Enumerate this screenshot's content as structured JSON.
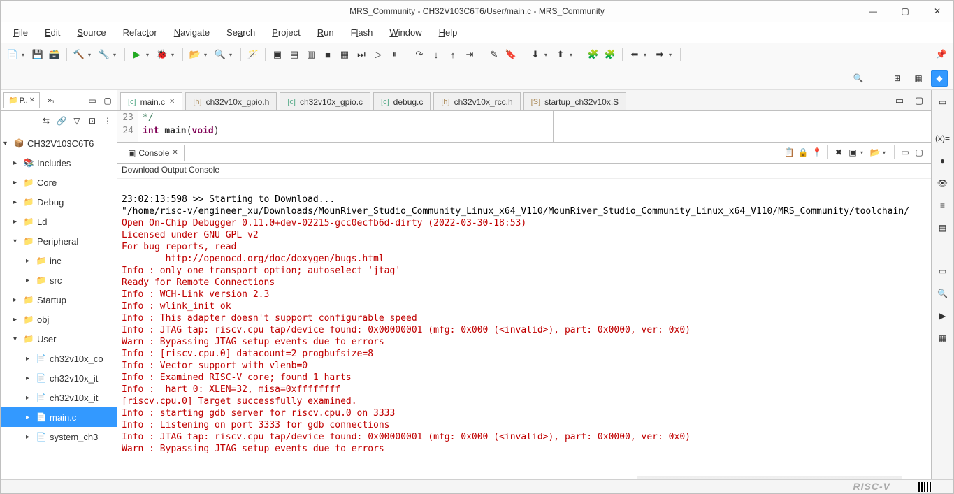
{
  "title": "MRS_Community - CH32V103C6T6/User/main.c - MRS_Community",
  "menus": [
    "File",
    "Edit",
    "Source",
    "Refactor",
    "Navigate",
    "Search",
    "Project",
    "Run",
    "Flash",
    "Window",
    "Help"
  ],
  "project_tree": {
    "root": "CH32V103C6T6",
    "items": [
      {
        "label": "Includes",
        "icon": "📚",
        "depth": 1,
        "arrow": "▸"
      },
      {
        "label": "Core",
        "icon": "📁",
        "depth": 1,
        "arrow": "▸"
      },
      {
        "label": "Debug",
        "icon": "📁",
        "depth": 1,
        "arrow": "▸"
      },
      {
        "label": "Ld",
        "icon": "📁",
        "depth": 1,
        "arrow": "▸"
      },
      {
        "label": "Peripheral",
        "icon": "📁",
        "depth": 1,
        "arrow": "▾"
      },
      {
        "label": "inc",
        "icon": "📁",
        "depth": 2,
        "arrow": "▸"
      },
      {
        "label": "src",
        "icon": "📁",
        "depth": 2,
        "arrow": "▸"
      },
      {
        "label": "Startup",
        "icon": "📁",
        "depth": 1,
        "arrow": "▸"
      },
      {
        "label": "obj",
        "icon": "📁",
        "depth": 1,
        "arrow": "▸"
      },
      {
        "label": "User",
        "icon": "📁",
        "depth": 1,
        "arrow": "▾"
      },
      {
        "label": "ch32v10x_co",
        "icon": "📄",
        "depth": 2,
        "arrow": "▸"
      },
      {
        "label": "ch32v10x_it",
        "icon": "📄",
        "depth": 2,
        "arrow": "▸"
      },
      {
        "label": "ch32v10x_it",
        "icon": "📄",
        "depth": 2,
        "arrow": "▸"
      },
      {
        "label": "main.c",
        "icon": "📄",
        "depth": 2,
        "arrow": "▸",
        "selected": true
      },
      {
        "label": "system_ch3",
        "icon": "📄",
        "depth": 2,
        "arrow": "▸"
      }
    ]
  },
  "editor_tabs": [
    {
      "label": "main.c",
      "icon": "c",
      "active": true,
      "closeable": true
    },
    {
      "label": "ch32v10x_gpio.h",
      "icon": "h"
    },
    {
      "label": "ch32v10x_gpio.c",
      "icon": "c"
    },
    {
      "label": "debug.c",
      "icon": "c"
    },
    {
      "label": "ch32v10x_rcc.h",
      "icon": "h"
    },
    {
      "label": "startup_ch32v10x.S",
      "icon": "S"
    }
  ],
  "code": {
    "line23_num": "23",
    "line24_num": "24",
    "line23": "*/",
    "line24_pre": "int ",
    "line24_fn": "main",
    "line24_mid": "(",
    "line24_kw": "void",
    "line24_end": ")"
  },
  "console": {
    "tab": "Console",
    "title": "Download Output Console",
    "lines": [
      {
        "c": "normal",
        "t": "23:02:13:598 >> Starting to Download..."
      },
      {
        "c": "normal",
        "t": "\"/home/risc-v/engineer_xu/Downloads/MounRiver_Studio_Community_Linux_x64_V110/MounRiver_Studio_Community_Linux_x64_V110/MRS_Community/toolchain/"
      },
      {
        "c": "red",
        "t": "Open On-Chip Debugger 0.11.0+dev-02215-gcc0ecfb6d-dirty (2022-03-30-18:53)"
      },
      {
        "c": "red",
        "t": "Licensed under GNU GPL v2"
      },
      {
        "c": "red",
        "t": "For bug reports, read"
      },
      {
        "c": "red",
        "t": "        http://openocd.org/doc/doxygen/bugs.html"
      },
      {
        "c": "red",
        "t": "Info : only one transport option; autoselect 'jtag'"
      },
      {
        "c": "red",
        "t": "Ready for Remote Connections"
      },
      {
        "c": "red",
        "t": "Info : WCH-Link version 2.3"
      },
      {
        "c": "red",
        "t": "Info : wlink_init ok"
      },
      {
        "c": "red",
        "t": "Info : This adapter doesn't support configurable speed"
      },
      {
        "c": "red",
        "t": "Info : JTAG tap: riscv.cpu tap/device found: 0x00000001 (mfg: 0x000 (<invalid>), part: 0x0000, ver: 0x0)"
      },
      {
        "c": "red",
        "t": "Warn : Bypassing JTAG setup events due to errors"
      },
      {
        "c": "red",
        "t": "Info : [riscv.cpu.0] datacount=2 progbufsize=8"
      },
      {
        "c": "red",
        "t": "Info : Vector support with vlenb=0"
      },
      {
        "c": "red",
        "t": "Info : Examined RISC-V core; found 1 harts"
      },
      {
        "c": "red",
        "t": "Info :  hart 0: XLEN=32, misa=0xffffffff"
      },
      {
        "c": "red",
        "t": "[riscv.cpu.0] Target successfully examined."
      },
      {
        "c": "red",
        "t": "Info : starting gdb server for riscv.cpu.0 on 3333"
      },
      {
        "c": "red",
        "t": "Info : Listening on port 3333 for gdb connections"
      },
      {
        "c": "red",
        "t": "Info : JTAG tap: riscv.cpu tap/device found: 0x00000001 (mfg: 0x000 (<invalid>), part: 0x0000, ver: 0x0)"
      },
      {
        "c": "red",
        "t": "Warn : Bypassing JTAG setup events due to errors"
      }
    ]
  },
  "left_tabs": {
    "tab1": "P..",
    "tab1_icon": "📁",
    "tab2": "»₁"
  },
  "branding": "RISC-V"
}
